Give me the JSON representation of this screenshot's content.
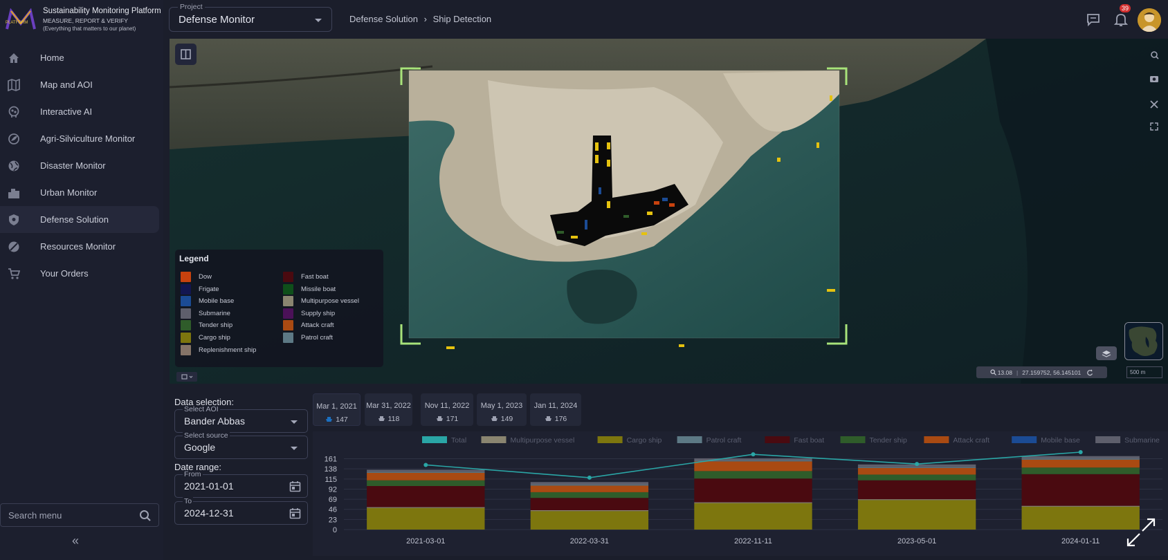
{
  "brand": {
    "title": "Sustainability Monitoring Platform",
    "tagline": "MEASURE, REPORT & VERIFY",
    "slogan": "(Everything that matters to our planet)",
    "logo_text": "PLATFORM"
  },
  "sidebar": {
    "items": [
      {
        "label": "Home",
        "icon": "home-icon"
      },
      {
        "label": "Map and AOI",
        "icon": "map-icon"
      },
      {
        "label": "Interactive AI",
        "icon": "brain-icon"
      },
      {
        "label": "Agri-Silviculture Monitor",
        "icon": "agri-icon"
      },
      {
        "label": "Disaster Monitor",
        "icon": "globe-icon"
      },
      {
        "label": "Urban Monitor",
        "icon": "city-icon"
      },
      {
        "label": "Defense Solution",
        "icon": "shield-icon",
        "active": true
      },
      {
        "label": "Resources Monitor",
        "icon": "resources-icon"
      },
      {
        "label": "Your Orders",
        "icon": "cart-icon"
      }
    ],
    "search_placeholder": "Search menu",
    "collapse": "«"
  },
  "topbar": {
    "project_label": "Project",
    "project_value": "Defense Monitor",
    "breadcrumb": [
      "Defense Solution",
      "Ship Detection"
    ],
    "notification_count": "39"
  },
  "legend": {
    "title": "Legend",
    "items": [
      {
        "label": "Dow",
        "color": "#c8420e"
      },
      {
        "label": "Fast boat",
        "color": "#4a0a10"
      },
      {
        "label": "Frigate",
        "color": "#131650"
      },
      {
        "label": "Missile boat",
        "color": "#0f4f1a"
      },
      {
        "label": "Mobile base",
        "color": "#1b4b94"
      },
      {
        "label": "Multipurpose vessel",
        "color": "#8a8570"
      },
      {
        "label": "Submarine",
        "color": "#5e5f6c"
      },
      {
        "label": "Supply ship",
        "color": "#4b1158"
      },
      {
        "label": "Tender ship",
        "color": "#2f5c2a"
      },
      {
        "label": "Attack craft",
        "color": "#a94a12"
      },
      {
        "label": "Cargo ship",
        "color": "#7d760e"
      },
      {
        "label": "Patrol craft",
        "color": "#5d7985"
      },
      {
        "label": "Replenishment ship",
        "color": "#857468"
      }
    ]
  },
  "map_status": {
    "zoom": "13.08",
    "coords": "27.159752,  56.145101",
    "scale": "500 m"
  },
  "data_selection": {
    "title": "Data selection:",
    "aoi_label": "Select AOI",
    "aoi_value": "Bander Abbas",
    "source_label": "Select source",
    "source_value": "Google",
    "date_range_title": "Date range:",
    "from_label": "From",
    "from_value": "2021-01-01",
    "to_label": "To",
    "to_value": "2024-12-31"
  },
  "dates": [
    {
      "date": "Mar 1, 2021",
      "count": "147"
    },
    {
      "date": "Mar 31, 2022",
      "count": "118"
    },
    {
      "date": "Nov 11, 2022",
      "count": "171"
    },
    {
      "date": "May 1, 2023",
      "count": "149"
    },
    {
      "date": "Jan 11, 2024",
      "count": "176"
    }
  ],
  "chart_data": {
    "type": "bar",
    "stacked": true,
    "categories": [
      "2021-03-01",
      "2022-03-31",
      "2022-11-11",
      "2023-05-01",
      "2024-01-11"
    ],
    "y_ticks": [
      0,
      23,
      46,
      69,
      92,
      115,
      138,
      161
    ],
    "ylim": [
      0,
      176
    ],
    "legend_position": "top",
    "series": [
      {
        "name": "Cargo ship",
        "color": "#7d760e",
        "values": [
          49,
          42,
          60,
          67,
          52
        ]
      },
      {
        "name": "Multipurpose vessel",
        "color": "#8a8570",
        "values": [
          2,
          2,
          2,
          2,
          2
        ]
      },
      {
        "name": "Fast boat",
        "color": "#4a0a10",
        "values": [
          48,
          28,
          54,
          43,
          72
        ]
      },
      {
        "name": "Tender ship",
        "color": "#2f5c2a",
        "values": [
          13,
          13,
          17,
          13,
          15
        ]
      },
      {
        "name": "Attack craft",
        "color": "#a94a12",
        "values": [
          17,
          15,
          22,
          15,
          18
        ]
      },
      {
        "name": "Mobile base",
        "color": "#1b4b94",
        "values": [
          0,
          0,
          0,
          0,
          0
        ]
      },
      {
        "name": "Patrol craft",
        "color": "#5d7985",
        "values": [
          2,
          2,
          2,
          2,
          2
        ]
      },
      {
        "name": "Submarine",
        "color": "#5e5f6c",
        "values": [
          5,
          6,
          5,
          6,
          6
        ]
      }
    ],
    "line": {
      "name": "Total",
      "color": "#2aa6a6",
      "values": [
        147,
        118,
        171,
        149,
        176
      ]
    },
    "legend_order": [
      "Total",
      "Multipurpose vessel",
      "Cargo ship",
      "Patrol craft",
      "Fast boat",
      "Tender ship",
      "Attack craft",
      "Mobile base",
      "Submarine"
    ]
  }
}
